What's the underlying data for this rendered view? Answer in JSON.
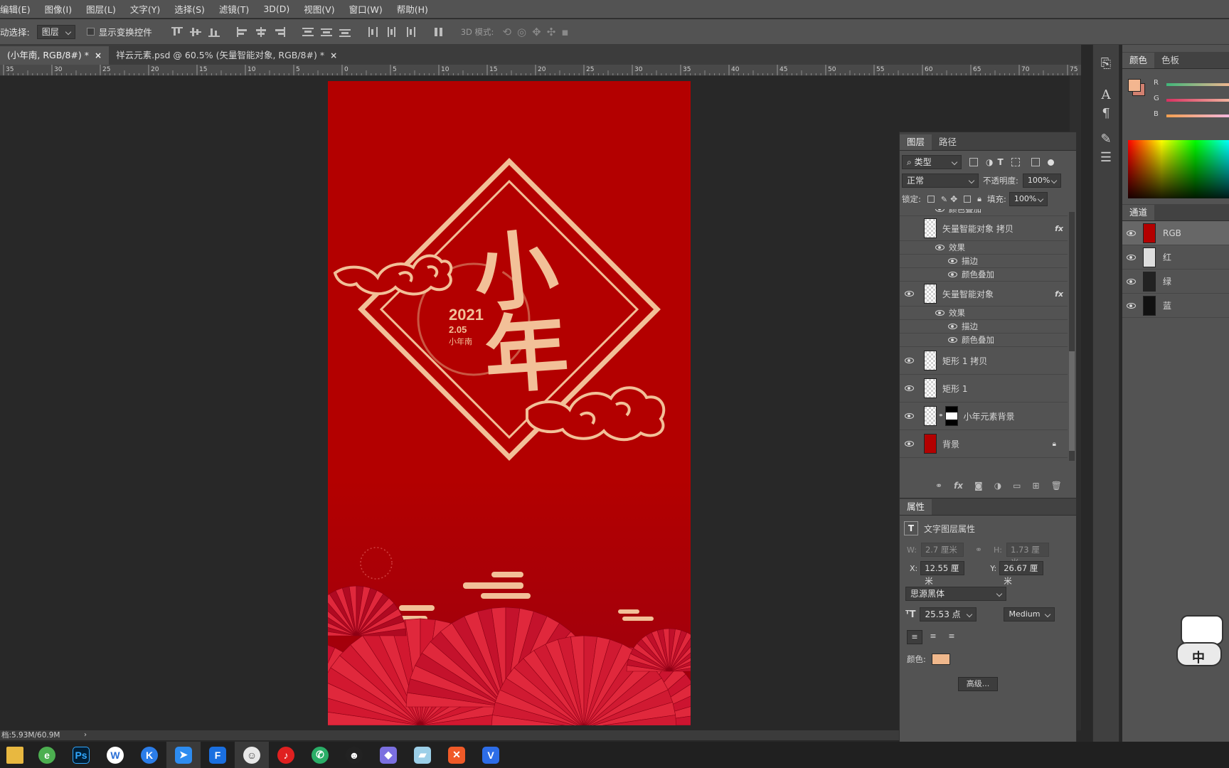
{
  "menu": [
    "编辑(E)",
    "图像(I)",
    "图层(L)",
    "文字(Y)",
    "选择(S)",
    "滤镜(T)",
    "3D(D)",
    "视图(V)",
    "窗口(W)",
    "帮助(H)"
  ],
  "options": {
    "auto_select_label": "动选择:",
    "auto_select_value": "图层",
    "show_transform_label": "显示变换控件",
    "mode_3d_label": "3D 模式:"
  },
  "tabs": [
    {
      "label": "(小年南, RGB/8#) *",
      "active": true
    },
    {
      "label": "祥云元素.psd @ 60.5% (矢量智能对象, RGB/8#) *",
      "active": false
    }
  ],
  "ruler_labels": [
    "35",
    "30",
    "25",
    "20",
    "15",
    "10",
    "5",
    "0",
    "5",
    "10",
    "15",
    "20",
    "25",
    "30",
    "35",
    "40",
    "45",
    "50",
    "55",
    "60",
    "65",
    "70",
    "75"
  ],
  "artwork": {
    "main_char1": "小",
    "main_char2": "年",
    "year": "2021",
    "date": "2.05",
    "sub": "小年南",
    "bg_color": "#b30000",
    "accent_color": "#f2c098"
  },
  "layers_panel": {
    "tabs": [
      "图层",
      "路径"
    ],
    "filter_label": "类型",
    "blend_mode": "正常",
    "opacity_label": "不透明度:",
    "opacity_value": "100%",
    "lock_label": "锁定:",
    "fill_label": "填充:",
    "fill_value": "100%",
    "partial_row": "颜色叠加",
    "layers": [
      {
        "name": "矢量智能对象 拷贝",
        "fx": "fx",
        "effects_label": "效果",
        "effects": [
          "描边",
          "颜色叠加"
        ],
        "visible": false
      },
      {
        "name": "矢量智能对象",
        "fx": "fx",
        "effects_label": "效果",
        "effects": [
          "描边",
          "颜色叠加"
        ],
        "visible": true
      },
      {
        "name": "矩形 1 拷贝",
        "visible": true
      },
      {
        "name": "矩形 1",
        "visible": true
      },
      {
        "name": "小年元素背景",
        "visible": true
      },
      {
        "name": "背景",
        "visible": true,
        "locked": true
      }
    ]
  },
  "properties_panel": {
    "title": "属性",
    "type_label": "文字图层属性",
    "w_label": "W:",
    "w_value": "2.7 厘米",
    "h_label": "H:",
    "h_value": "1.73 厘米",
    "x_label": "X:",
    "x_value": "12.55 厘米",
    "y_label": "Y:",
    "y_value": "26.67 厘米",
    "font": "思源黑体",
    "size": "25.53 点",
    "weight": "Medium",
    "color_label": "颜色:",
    "color": "#f0b88c",
    "advanced": "高级..."
  },
  "color_panel": {
    "tabs": [
      "颜色",
      "色板"
    ],
    "channels": [
      "R",
      "G",
      "B"
    ],
    "fg_color": "#f3b690"
  },
  "channels_panel": {
    "title": "通道",
    "channels": [
      "RGB",
      "红",
      "绿",
      "蓝"
    ]
  },
  "status_text": "档:5.93M/60.9M",
  "sticker_text": "中",
  "taskbar_labels": [
    "Ps",
    "W",
    "K",
    "F"
  ]
}
